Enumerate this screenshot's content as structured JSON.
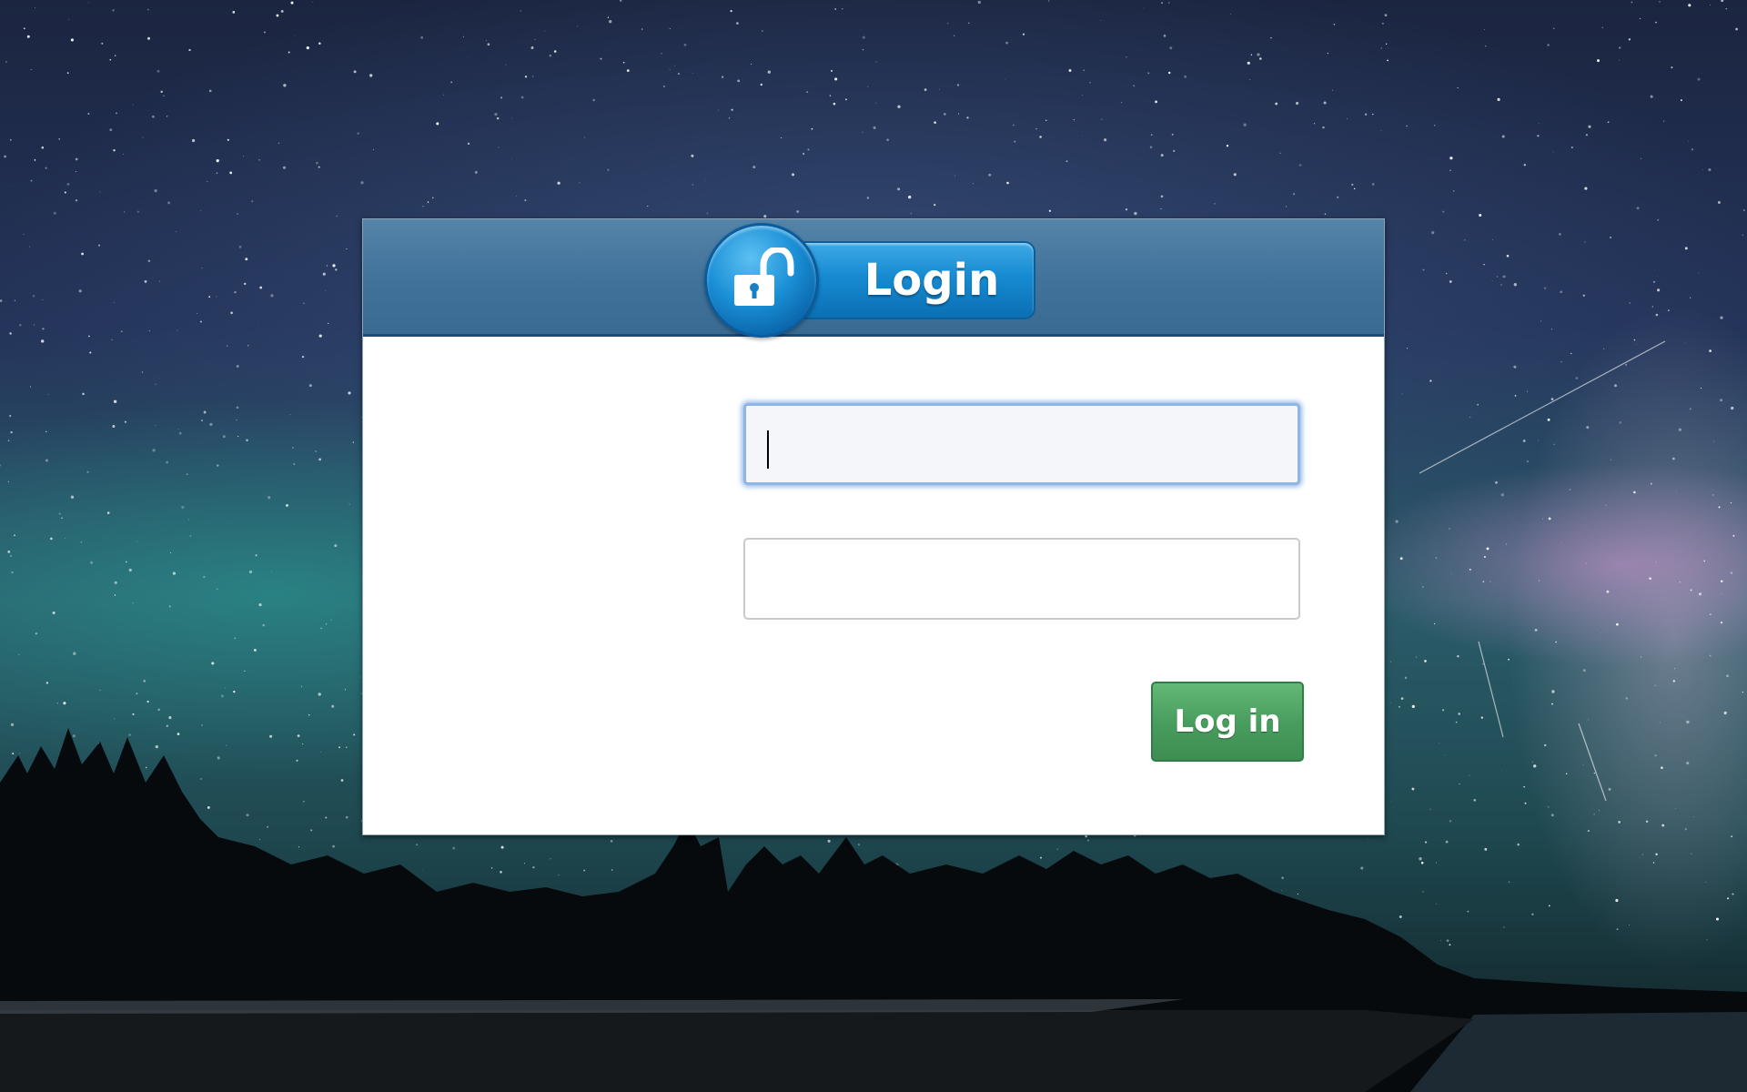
{
  "dialog": {
    "title": "Login",
    "lock_icon": "unlocked-padlock-icon",
    "username": {
      "value": "",
      "placeholder": ""
    },
    "password": {
      "value": "",
      "placeholder": ""
    },
    "submit_label": "Log in"
  },
  "colors": {
    "header": "#42739b",
    "badge": "#168bd2",
    "focus_ring": "#8fb5e2",
    "button": "#479c5d"
  }
}
